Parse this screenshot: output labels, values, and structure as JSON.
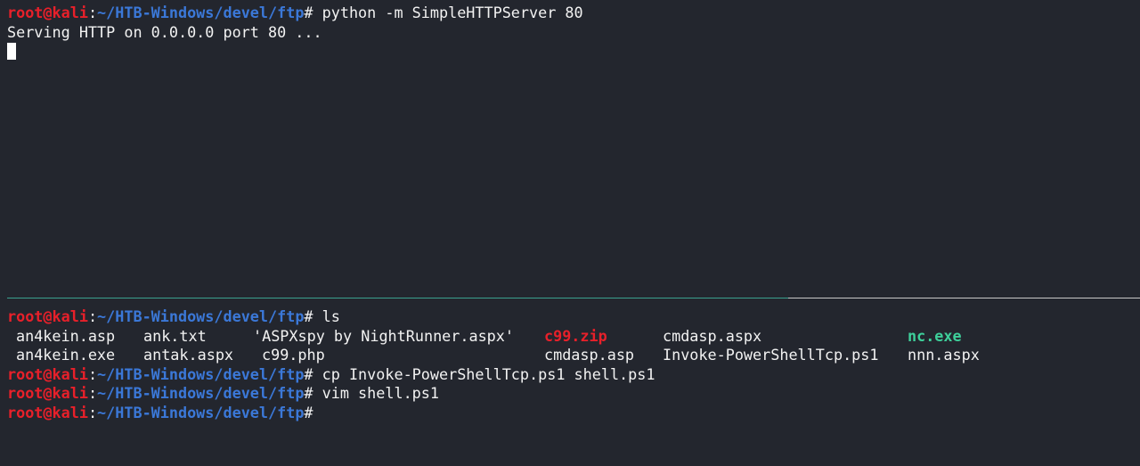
{
  "prompt": {
    "user": "root@kali",
    "path": "~/HTB-Windows/devel/ftp",
    "symbol": "#"
  },
  "top_pane": {
    "command": "python -m SimpleHTTPServer 80",
    "output": "Serving HTTP on 0.0.0.0 port 80 ..."
  },
  "bottom_pane": {
    "cmd1": "ls",
    "ls_row1": {
      "f1": "an4kein.asp",
      "f2": "ank.txt",
      "f3": "'ASPXspy by NightRunner.aspx'",
      "f4": "c99.zip",
      "f5": "cmdasp.aspx",
      "f6": "nc.exe"
    },
    "ls_row2": {
      "f1": "an4kein.exe",
      "f2": "antak.aspx",
      "f3": "c99.php",
      "f4": "cmdasp.asp",
      "f5": "Invoke-PowerShellTcp.ps1",
      "f6": "nnn.aspx"
    },
    "cmd2": "cp Invoke-PowerShellTcp.ps1 shell.ps1",
    "cmd3": "vim shell.ps1"
  },
  "colors": {
    "background": "#23262e",
    "user": "#e8202a",
    "path": "#3b78d8",
    "text": "#f2f2f2",
    "archive": "#e8202a",
    "executable": "#3ecf9a",
    "divider_active": "#3aa08e"
  }
}
